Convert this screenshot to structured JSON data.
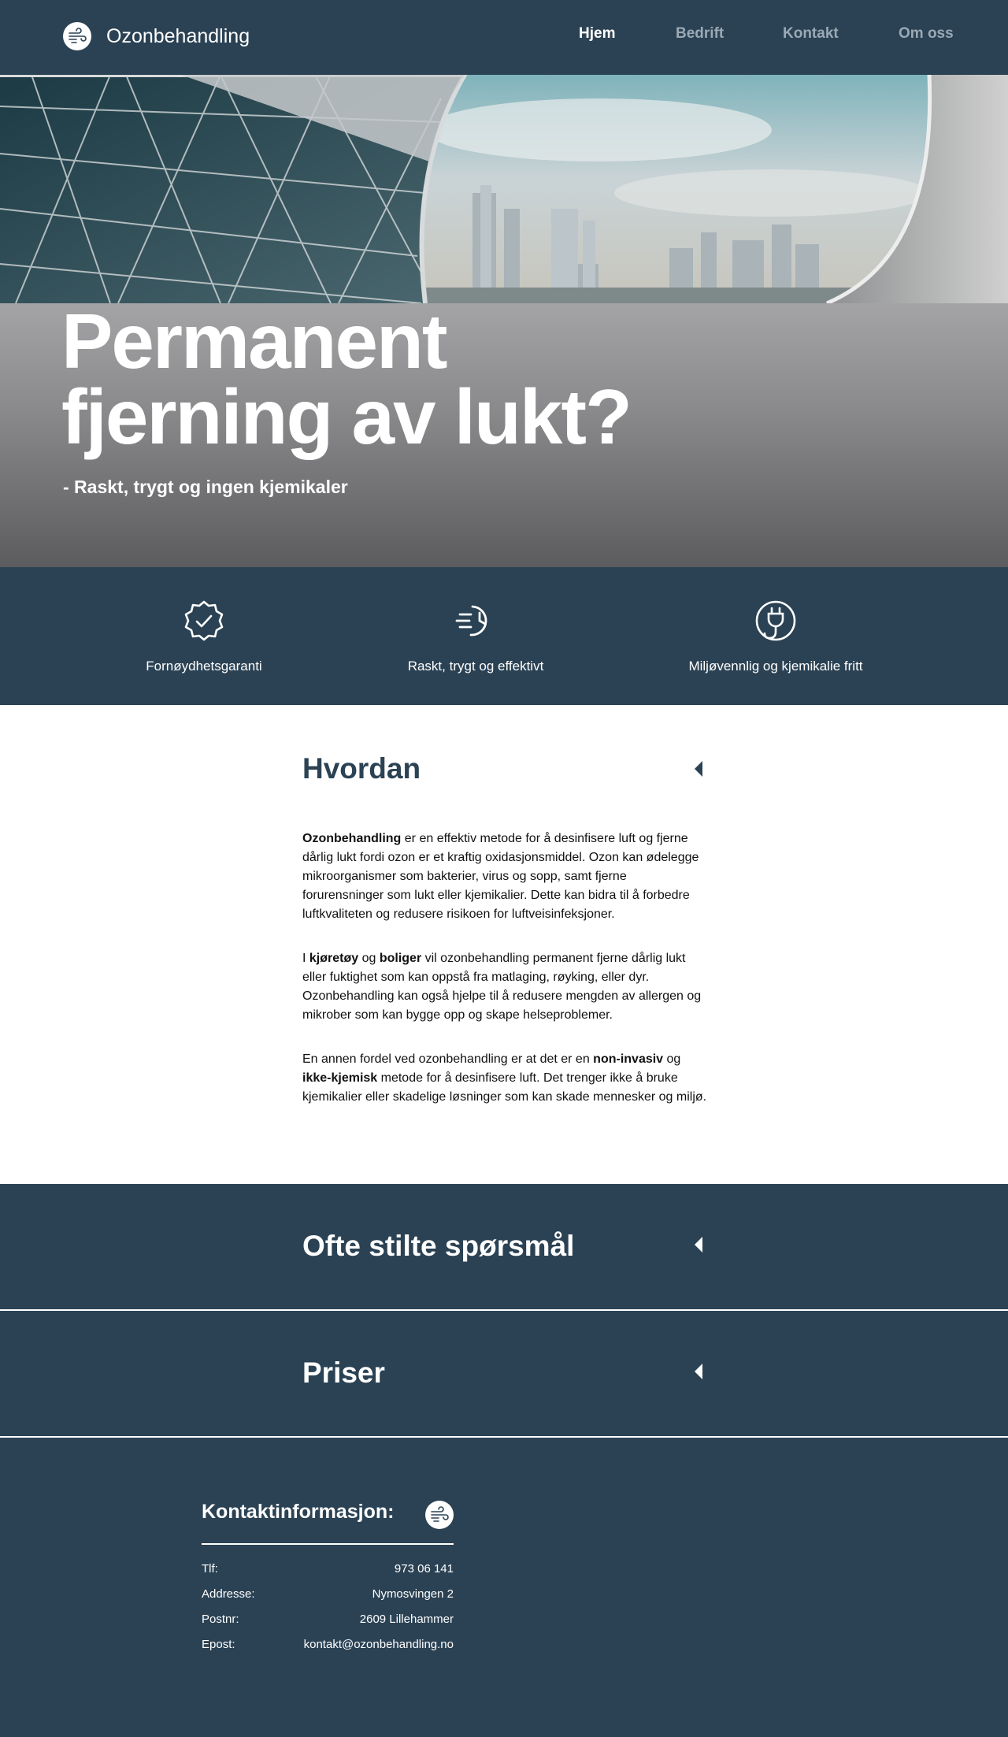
{
  "nav": {
    "brand": "Ozonbehandling",
    "links": [
      {
        "label": "Hjem",
        "active": true
      },
      {
        "label": "Bedrift",
        "active": false
      },
      {
        "label": "Kontakt",
        "active": false
      },
      {
        "label": "Om oss",
        "active": false
      }
    ]
  },
  "hero": {
    "title_line1": "Permanent",
    "title_line2": "fjerning av lukt?",
    "subtitle": "- Raskt, trygt og ingen kjemikaler"
  },
  "features": [
    {
      "icon": "badge-check-icon",
      "label": "Fornøydhetsgaranti"
    },
    {
      "icon": "fast-clock-icon",
      "label": "Raskt, trygt og effektivt"
    },
    {
      "icon": "eco-plug-icon",
      "label": "Miljøvennlig og kjemikalie fritt"
    }
  ],
  "hvordan": {
    "title": "Hvordan",
    "p1_bold": "Ozonbehandling",
    "p1_rest": " er en effektiv metode for å desinfisere luft og fjerne dårlig lukt fordi ozon er et kraftig oxidasjonsmiddel. Ozon kan ødelegge mikroorganismer som bakterier, virus og sopp, samt fjerne forurensninger som lukt eller kjemikalier. Dette kan bidra til å forbedre luftkvaliteten og redusere risikoen for luftveisinfeksjoner.",
    "p2_a": "I ",
    "p2_b1": "kjøretøy",
    "p2_c": " og ",
    "p2_b2": "boliger",
    "p2_d": " vil ozonbehandling permanent fjerne dårlig lukt eller fuktighet som kan oppstå fra matlaging, røyking, eller dyr. Ozonbehandling kan også hjelpe til å redusere mengden av allergen og mikrober som kan bygge opp og skape helseproblemer.",
    "p3_a": "En annen fordel ved ozonbehandling er at det er en ",
    "p3_b1": "non-invasiv",
    "p3_c": " og ",
    "p3_b2": "ikke-kjemisk",
    "p3_d": " metode for å desinfisere luft. Det trenger ikke å bruke kjemikalier eller skadelige løsninger som kan skade mennesker og miljø."
  },
  "faq": {
    "title": "Ofte stilte spørsmål"
  },
  "priser": {
    "title": "Priser"
  },
  "footer": {
    "title": "Kontaktinformasjon:",
    "rows": [
      {
        "label": "Tlf:",
        "value": "973 06 141"
      },
      {
        "label": "Addresse:",
        "value": "Nymosvingen 2"
      },
      {
        "label": "Postnr:",
        "value": "2609 Lillehammer"
      },
      {
        "label": "Epost:",
        "value": "kontakt@ozonbehandling.no"
      }
    ]
  },
  "colors": {
    "primary": "#2b4254",
    "white": "#ffffff",
    "muted_nav": "#9aa9b5"
  }
}
